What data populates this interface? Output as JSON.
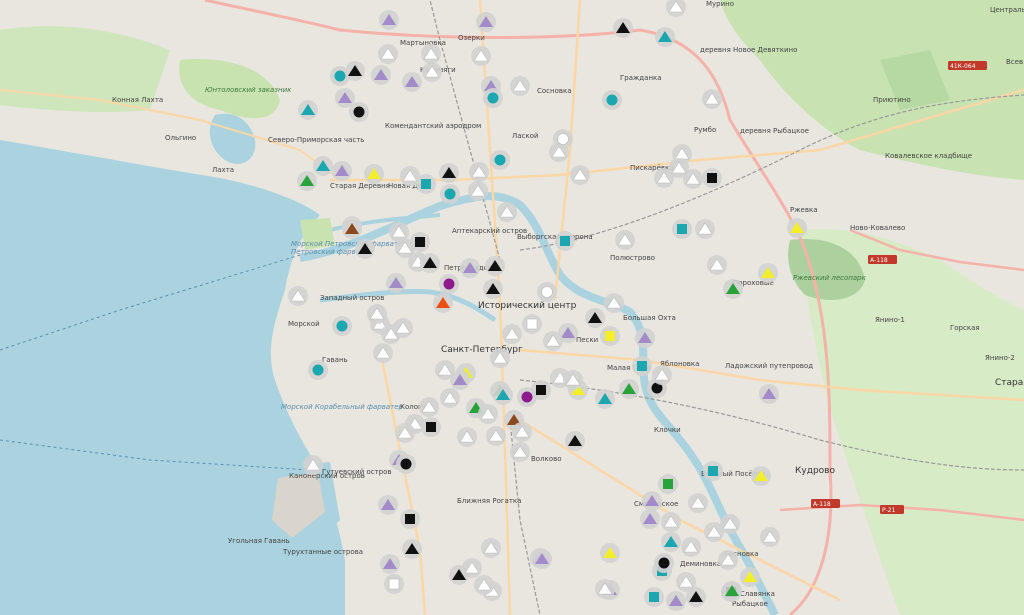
{
  "colors": {
    "sea": "#aad3df",
    "land": "#e8e6df",
    "park": "#c8e3b0",
    "forest": "#add19e",
    "road_major": "#f4b2a8",
    "road_secondary": "#fcd6a4",
    "rail": "#999999",
    "marker_gray": "#d2d2d2",
    "marker_white": "#ffffff",
    "marker_black": "#111111",
    "marker_teal": "#1aa7b0",
    "marker_lilac": "#a38bc9",
    "marker_yellow": "#f2ee2a",
    "marker_green": "#27a33a",
    "marker_purple": "#8e1b8e",
    "marker_brown": "#8b4a1c",
    "marker_orange": "#ee4d10"
  },
  "labels": [
    {
      "text": "Юнтоловский заказник",
      "cls": "green"
    },
    {
      "text": "Конная Лахта",
      "cls": "n"
    },
    {
      "text": "Ольгино",
      "cls": "n"
    },
    {
      "text": "Северо-Приморская часть",
      "cls": "n"
    },
    {
      "text": "Лахта",
      "cls": "n"
    },
    {
      "text": "Мартыновка",
      "cls": "n"
    },
    {
      "text": "Озерки",
      "cls": "n"
    },
    {
      "text": "Коломяги",
      "cls": "n"
    },
    {
      "text": "Комендантский аэродром",
      "cls": "n"
    },
    {
      "text": "Старая Деревня",
      "cls": "n"
    },
    {
      "text": "Новая Де",
      "cls": "n"
    },
    {
      "text": "Сосновка",
      "cls": "n"
    },
    {
      "text": "Лаской",
      "cls": "n"
    },
    {
      "text": "Гражданка",
      "cls": "n"
    },
    {
      "text": "Мурино",
      "cls": "n"
    },
    {
      "text": "деревня Новое Девяткино",
      "cls": "n"
    },
    {
      "text": "Пискарёвка",
      "cls": "n"
    },
    {
      "text": "Румбо",
      "cls": "n"
    },
    {
      "text": "деревня Рыбацкое",
      "cls": "n"
    },
    {
      "text": "Приютино",
      "cls": "n"
    },
    {
      "text": "Ковалевское кладбище",
      "cls": "n"
    },
    {
      "text": "Ржевка",
      "cls": "n"
    },
    {
      "text": "Ново-Ковалево",
      "cls": "n"
    },
    {
      "text": "Аптекарский остров",
      "cls": "n"
    },
    {
      "text": "Выборгская сторона",
      "cls": "n"
    },
    {
      "text": "Полюстрово",
      "cls": "n"
    },
    {
      "text": "Петроградский",
      "cls": "n"
    },
    {
      "text": "Исторический центр",
      "cls": "big"
    },
    {
      "text": "Санкт-Петербург",
      "cls": "big"
    },
    {
      "text": "Пороховые",
      "cls": "n"
    },
    {
      "text": "Ржевский лесопарк",
      "cls": "green"
    },
    {
      "text": "Янино-1",
      "cls": "n"
    },
    {
      "text": "Горская",
      "cls": "n"
    },
    {
      "text": "Янино-2",
      "cls": "n"
    },
    {
      "text": "Старая",
      "cls": "big"
    },
    {
      "text": "Большая Охта",
      "cls": "n"
    },
    {
      "text": "Пески",
      "cls": "n"
    },
    {
      "text": "Малая Охта",
      "cls": "n"
    },
    {
      "text": "Яблоновка",
      "cls": "n"
    },
    {
      "text": "Ладожский путепровод",
      "cls": "n"
    },
    {
      "text": "Морской",
      "cls": "n"
    },
    {
      "text": "Гавань",
      "cls": "n"
    },
    {
      "text": "Западный остров",
      "cls": "n"
    },
    {
      "text": "Петровский фарватер",
      "cls": "water"
    },
    {
      "text": "Морской Петровский фарватер",
      "cls": "water"
    },
    {
      "text": "Морской Корабельный фарватер",
      "cls": "water"
    },
    {
      "text": "Коломна",
      "cls": "n"
    },
    {
      "text": "Волково",
      "cls": "n"
    },
    {
      "text": "Ближняя Рогатка",
      "cls": "n"
    },
    {
      "text": "Канонерский остров",
      "cls": "n"
    },
    {
      "text": "Гутуевский остров",
      "cls": "n"
    },
    {
      "text": "Угольная Гавань",
      "cls": "n"
    },
    {
      "text": "Турухтанные острова",
      "cls": "n"
    },
    {
      "text": "Клочки",
      "cls": "n"
    },
    {
      "text": "Весёлый Посёлок",
      "cls": "n"
    },
    {
      "text": "Кудрово",
      "cls": "big"
    },
    {
      "text": "Смоленское",
      "cls": "n"
    },
    {
      "text": "Сосновка",
      "cls": "n"
    },
    {
      "text": "Деминовка",
      "cls": "n"
    },
    {
      "text": "Усть-Славянка",
      "cls": "n"
    },
    {
      "text": "Рыбацкое",
      "cls": "n"
    },
    {
      "text": "Центральный Всеволожск",
      "cls": "n"
    },
    {
      "text": "Всев",
      "cls": "n"
    }
  ],
  "shields": [
    "41К-064",
    "А-118",
    "А-118",
    "Р-21"
  ],
  "markers": [
    {
      "s": "tri",
      "c": "lilac"
    },
    {
      "s": "tri",
      "c": "lilac"
    },
    {
      "s": "tri",
      "c": "white"
    },
    {
      "s": "tri",
      "c": "white"
    },
    {
      "s": "tri",
      "c": "black"
    },
    {
      "s": "tri",
      "c": "teal"
    },
    {
      "s": "tri",
      "c": "white"
    },
    {
      "s": "tri",
      "c": "white"
    },
    {
      "s": "tri",
      "c": "white"
    },
    {
      "s": "cir",
      "c": "teal"
    },
    {
      "s": "tri",
      "c": "black"
    },
    {
      "s": "tri",
      "c": "lilac"
    },
    {
      "s": "tri",
      "c": "lilac"
    },
    {
      "s": "tri",
      "c": "lilac"
    },
    {
      "s": "cir",
      "c": "teal"
    },
    {
      "s": "cir",
      "c": "teal"
    },
    {
      "s": "tri",
      "c": "white"
    },
    {
      "s": "tri",
      "c": "lilac"
    },
    {
      "s": "cir",
      "c": "black"
    },
    {
      "s": "tri",
      "c": "teal"
    },
    {
      "s": "tri",
      "c": "white"
    },
    {
      "s": "tri",
      "c": "teal"
    },
    {
      "s": "tri",
      "c": "lilac"
    },
    {
      "s": "tri",
      "c": "green"
    },
    {
      "s": "tri",
      "c": "yellow"
    },
    {
      "s": "tri",
      "c": "white"
    },
    {
      "s": "sq",
      "c": "teal"
    },
    {
      "s": "cir",
      "c": "teal"
    },
    {
      "s": "tri",
      "c": "black"
    },
    {
      "s": "tri",
      "c": "white"
    },
    {
      "s": "tri",
      "c": "white"
    },
    {
      "s": "cir",
      "c": "teal"
    },
    {
      "s": "tri",
      "c": "white"
    },
    {
      "s": "cir",
      "c": "white"
    },
    {
      "s": "tri",
      "c": "white"
    },
    {
      "s": "tri",
      "c": "white"
    },
    {
      "s": "tri",
      "c": "white"
    },
    {
      "s": "tri",
      "c": "white"
    },
    {
      "s": "sq",
      "c": "black"
    },
    {
      "s": "tri",
      "c": "white"
    },
    {
      "s": "tri",
      "c": "white"
    },
    {
      "s": "tri",
      "c": "brown"
    },
    {
      "s": "tri",
      "c": "black"
    },
    {
      "s": "tri",
      "c": "white"
    },
    {
      "s": "tri",
      "c": "white"
    },
    {
      "s": "sq",
      "c": "black"
    },
    {
      "s": "tri",
      "c": "white"
    },
    {
      "s": "tri",
      "c": "lilac"
    },
    {
      "s": "tri",
      "c": "black"
    },
    {
      "s": "tri",
      "c": "black"
    },
    {
      "s": "tri",
      "c": "black"
    },
    {
      "s": "cir",
      "c": "purple"
    },
    {
      "s": "tri",
      "c": "orange"
    },
    {
      "s": "tri",
      "c": "lilac"
    },
    {
      "s": "sq",
      "c": "teal"
    },
    {
      "s": "tri",
      "c": "white"
    },
    {
      "s": "sq",
      "c": "teal"
    },
    {
      "s": "tri",
      "c": "white"
    },
    {
      "s": "tri",
      "c": "yellow"
    },
    {
      "s": "tri",
      "c": "white"
    },
    {
      "s": "tri",
      "c": "yellow"
    },
    {
      "s": "tri",
      "c": "green"
    },
    {
      "s": "tri",
      "c": "white"
    },
    {
      "s": "cir",
      "c": "white"
    },
    {
      "s": "tri",
      "c": "white"
    },
    {
      "s": "cir",
      "c": "teal"
    },
    {
      "s": "tri",
      "c": "white"
    },
    {
      "s": "tri",
      "c": "white"
    },
    {
      "s": "tri",
      "c": "white"
    },
    {
      "s": "tri",
      "c": "white"
    },
    {
      "s": "tri",
      "c": "white"
    },
    {
      "s": "cir",
      "c": "teal"
    },
    {
      "s": "tri",
      "c": "white"
    },
    {
      "s": "tri",
      "c": "black"
    },
    {
      "s": "tri",
      "c": "lilac"
    },
    {
      "s": "tri",
      "c": "lilac"
    },
    {
      "s": "sq",
      "c": "white"
    },
    {
      "s": "tri",
      "c": "white"
    },
    {
      "s": "tri",
      "c": "white"
    },
    {
      "s": "sq",
      "c": "yellow"
    },
    {
      "s": "tri",
      "c": "white"
    },
    {
      "s": "tri",
      "c": "yellow"
    },
    {
      "s": "tri",
      "c": "white"
    },
    {
      "s": "tri",
      "c": "lilac"
    },
    {
      "s": "cir",
      "c": "purple"
    },
    {
      "s": "tri",
      "c": "green"
    },
    {
      "s": "sq",
      "c": "black"
    },
    {
      "s": "tri",
      "c": "white"
    },
    {
      "s": "tri",
      "c": "white"
    },
    {
      "s": "tri",
      "c": "white"
    },
    {
      "s": "tri",
      "c": "yellow"
    },
    {
      "s": "tri",
      "c": "teal"
    },
    {
      "s": "tri",
      "c": "white"
    },
    {
      "s": "tri",
      "c": "green"
    },
    {
      "s": "cir",
      "c": "black"
    },
    {
      "s": "sq",
      "c": "teal"
    },
    {
      "s": "tri",
      "c": "white"
    },
    {
      "s": "tri",
      "c": "lilac"
    },
    {
      "s": "tri",
      "c": "white"
    },
    {
      "s": "tri",
      "c": "white"
    },
    {
      "s": "sq",
      "c": "black"
    },
    {
      "s": "tri",
      "c": "white"
    },
    {
      "s": "tri",
      "c": "green"
    },
    {
      "s": "tri",
      "c": "white"
    },
    {
      "s": "tri",
      "c": "teal"
    },
    {
      "s": "tri",
      "c": "white"
    },
    {
      "s": "tri",
      "c": "brown"
    },
    {
      "s": "tri",
      "c": "white"
    },
    {
      "s": "tri",
      "c": "white"
    },
    {
      "s": "tri",
      "c": "black"
    },
    {
      "s": "tri",
      "c": "lilac"
    },
    {
      "s": "cir",
      "c": "black"
    },
    {
      "s": "tri",
      "c": "white"
    },
    {
      "s": "sq",
      "c": "green"
    },
    {
      "s": "tri",
      "c": "white"
    },
    {
      "s": "sq",
      "c": "teal"
    },
    {
      "s": "tri",
      "c": "lilac"
    },
    {
      "s": "tri",
      "c": "white"
    },
    {
      "s": "tri",
      "c": "white"
    },
    {
      "s": "tri",
      "c": "lilac"
    },
    {
      "s": "sq",
      "c": "black"
    },
    {
      "s": "tri",
      "c": "lilac"
    },
    {
      "s": "tri",
      "c": "black"
    },
    {
      "s": "tri",
      "c": "lilac"
    },
    {
      "s": "tri",
      "c": "white"
    },
    {
      "s": "tri",
      "c": "white"
    },
    {
      "s": "tri",
      "c": "black"
    },
    {
      "s": "tri",
      "c": "white"
    },
    {
      "s": "tri",
      "c": "white"
    },
    {
      "s": "sq",
      "c": "white"
    },
    {
      "s": "tri",
      "c": "lilac"
    },
    {
      "s": "tri",
      "c": "lilac"
    },
    {
      "s": "sq",
      "c": "teal"
    },
    {
      "s": "tri",
      "c": "white"
    },
    {
      "s": "tri",
      "c": "white"
    },
    {
      "s": "tri",
      "c": "white"
    },
    {
      "s": "cir",
      "c": "black"
    },
    {
      "s": "tri",
      "c": "yellow"
    },
    {
      "s": "sq",
      "c": "black"
    },
    {
      "s": "tri",
      "c": "black"
    },
    {
      "s": "tri",
      "c": "lilac"
    },
    {
      "s": "sq",
      "c": "teal"
    },
    {
      "s": "tri",
      "c": "teal"
    },
    {
      "s": "tri",
      "c": "yellow"
    },
    {
      "s": "tri",
      "c": "yellow"
    },
    {
      "s": "tri",
      "c": "green"
    },
    {
      "s": "tri",
      "c": "white"
    },
    {
      "s": "tri",
      "c": "white"
    },
    {
      "s": "tri",
      "c": "white"
    },
    {
      "s": "tri",
      "c": "lilac"
    },
    {
      "s": "tri",
      "c": "white"
    }
  ]
}
